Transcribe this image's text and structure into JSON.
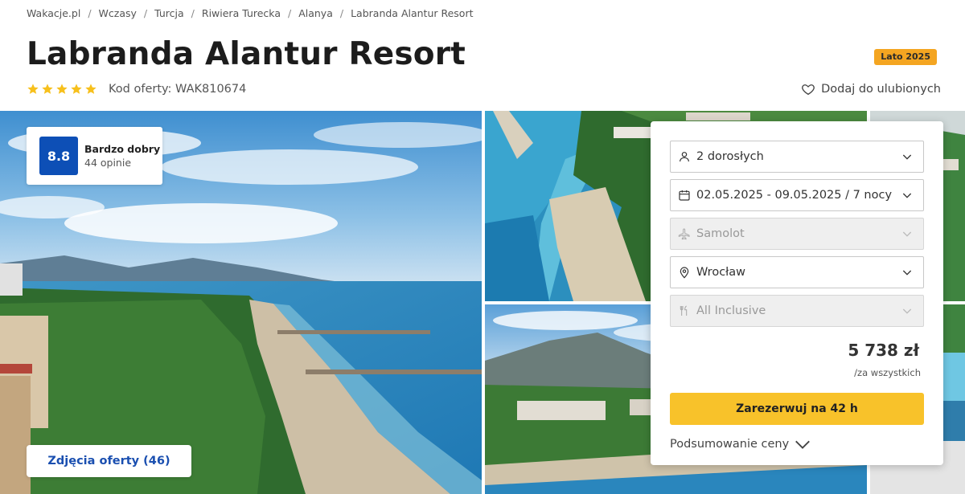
{
  "breadcrumb": [
    "Wakacje.pl",
    "Wczasy",
    "Turcja",
    "Riwiera Turecka",
    "Alanya",
    "Labranda Alantur Resort"
  ],
  "title": "Labranda Alantur Resort",
  "season_badge": "Lato 2025",
  "stars": 5,
  "offer_code": "Kod oferty: WAK810674",
  "favorite_label": "Dodaj do ulubionych",
  "rating": {
    "score": "8.8",
    "label": "Bardzo dobry",
    "count": "44 opinie"
  },
  "photos_button": "Zdjęcia oferty (46)",
  "booking": {
    "guests": "2 dorosłych",
    "dates": "02.05.2025 - 09.05.2025 / 7 nocy",
    "transport": "Samolot",
    "departure": "Wrocław",
    "board": "All Inclusive",
    "price": "5 738 zł",
    "price_note": "/za wszystkich",
    "book_button": "Zarezerwuj na 42 h",
    "summary_link": "Podsumowanie ceny"
  },
  "colors": {
    "accent_blue": "#0d4fb6",
    "cta_yellow": "#f8c22a",
    "badge_orange": "#f4a521",
    "star_yellow": "#f7c01c"
  },
  "icons": [
    "star-icon",
    "heart-icon",
    "user-icon",
    "calendar-icon",
    "plane-icon",
    "location-pin-icon",
    "cutlery-icon",
    "chevron-down-icon"
  ]
}
